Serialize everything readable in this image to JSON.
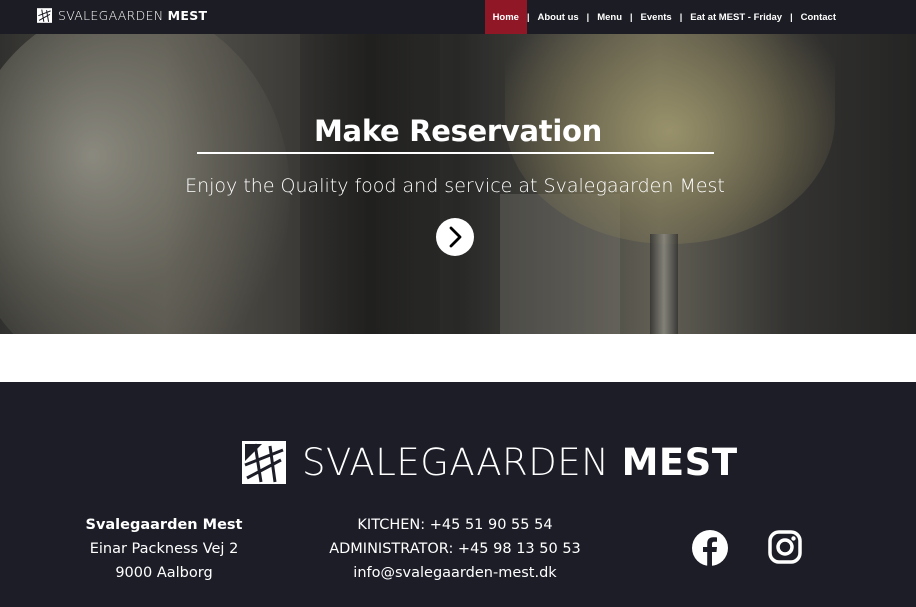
{
  "nav": {
    "brand_light": "SVALEGAARDEN ",
    "brand_bold": "MEST",
    "items": [
      {
        "label": "Home",
        "active": true
      },
      {
        "label": "About us"
      },
      {
        "label": "Menu"
      },
      {
        "label": "Events"
      },
      {
        "label": "Eat at MEST - Friday"
      },
      {
        "label": "Contact"
      }
    ],
    "separator": "|"
  },
  "hero": {
    "title": "Make Reservation",
    "subtitle": "Enjoy the Quality food and service at Svalegaarden Mest",
    "button_icon": "chevron-right-icon"
  },
  "footer": {
    "logo_light": "SVALEGAARDEN ",
    "logo_bold": "MEST",
    "address": {
      "name": "Svalegaarden Mest",
      "street": "Einar Packness Vej 2",
      "city": "9000 Aalborg"
    },
    "contact": {
      "kitchen": "KITCHEN: +45 51 90 55 54",
      "administrator": "ADMINISTRATOR: +45 98 13 50 53",
      "email": "info@svalegaarden-mest.dk"
    },
    "social": [
      "facebook-icon",
      "instagram-icon"
    ]
  },
  "colors": {
    "nav_bg": "#1c1d24",
    "active_bg": "#8f1726",
    "footer_bg": "#1c1d27"
  }
}
